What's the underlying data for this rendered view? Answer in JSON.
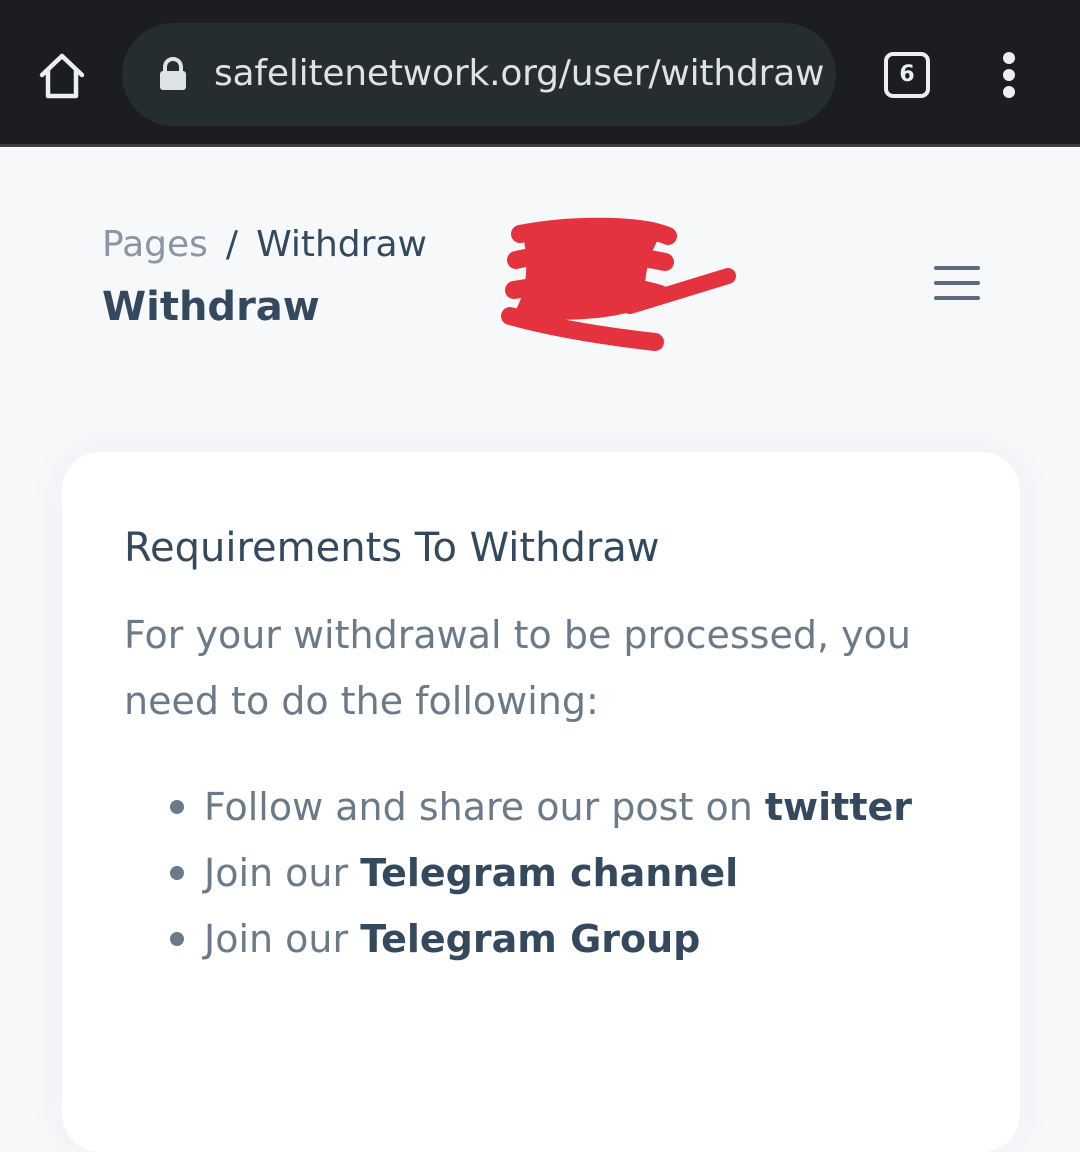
{
  "browser": {
    "url": "safelitenetwork.org/user/withdraw",
    "tab_count": "6"
  },
  "header": {
    "breadcrumb": {
      "parent": "Pages",
      "separator": "/",
      "current": "Withdraw"
    },
    "title": "Withdraw"
  },
  "card": {
    "title": "Requirements To Withdraw",
    "description": "For your withdrawal to be processed, you need to do the following:",
    "requirements": [
      {
        "prefix": "Follow and share our post on ",
        "link": "twitter"
      },
      {
        "prefix": "Join our ",
        "link": "Telegram channel"
      },
      {
        "prefix": "Join our ",
        "link": "Telegram Group"
      }
    ]
  },
  "colors": {
    "chrome_bg": "#1b1d21",
    "urlbar_bg": "#252d31",
    "page_bg": "#f7f8fa",
    "heading": "#34495e",
    "body_text": "#6b7a89",
    "redaction": "#e5323f"
  },
  "icons": [
    "home-icon",
    "lock-icon",
    "tab-switcher-icon",
    "more-vert-icon",
    "hamburger-menu-icon"
  ]
}
